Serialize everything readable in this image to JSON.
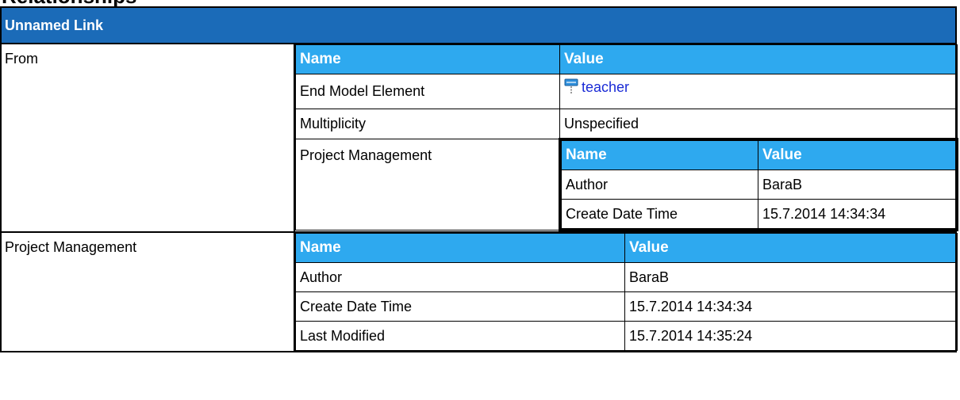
{
  "header": {
    "title": "Unnamed Link"
  },
  "from": {
    "label": "From",
    "columns": {
      "name": "Name",
      "value": "Value"
    },
    "end_model_element": {
      "name": "End Model Element",
      "value": "teacher",
      "icon": "class-element-icon"
    },
    "multiplicity": {
      "name": "Multiplicity",
      "value": "Unspecified"
    },
    "project_management": {
      "name": "Project Management",
      "columns": {
        "name": "Name",
        "value": "Value"
      },
      "rows": [
        {
          "name": "Author",
          "value": "BaraB"
        },
        {
          "name": "Create Date Time",
          "value": "15.7.2014 14:34:34"
        }
      ]
    }
  },
  "project_management": {
    "label": "Project Management",
    "columns": {
      "name": "Name",
      "value": "Value"
    },
    "rows": [
      {
        "name": "Author",
        "value": "BaraB"
      },
      {
        "name": "Create Date Time",
        "value": "15.7.2014 14:34:34"
      },
      {
        "name": "Last Modified",
        "value": "15.7.2014 14:35:24"
      }
    ]
  },
  "colors": {
    "header_bar": "#1b6bb8",
    "column_header": "#2ea9ef",
    "link": "#1a2bd6"
  }
}
